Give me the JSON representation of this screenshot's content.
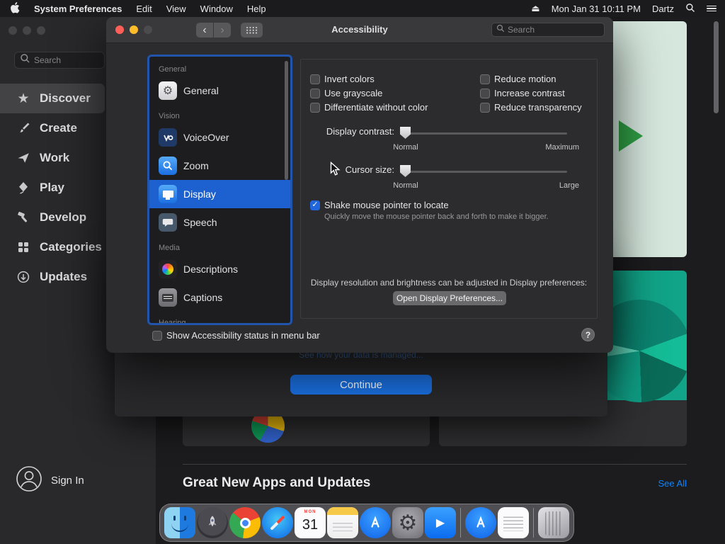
{
  "menubar": {
    "app_name": "System Preferences",
    "menus": [
      "Edit",
      "View",
      "Window",
      "Help"
    ],
    "clock": "Mon Jan 31 10:11 PM",
    "user": "Dartz"
  },
  "icons": {
    "star": "★",
    "eject": "⏏",
    "chevron_left": "‹",
    "chevron_right": "›",
    "gear": "⚙",
    "play": "▶",
    "check": "✓"
  },
  "appstore": {
    "search_placeholder": "Search",
    "nav": [
      {
        "label": "Discover"
      },
      {
        "label": "Create"
      },
      {
        "label": "Work"
      },
      {
        "label": "Play"
      },
      {
        "label": "Develop"
      },
      {
        "label": "Categories"
      },
      {
        "label": "Updates"
      }
    ],
    "sign_in": "Sign In",
    "heading": "Great New Apps and Updates",
    "see_all": "See All"
  },
  "dialog": {
    "data_link": "See how your data is managed...",
    "continue_label": "Continue"
  },
  "prefs": {
    "window_title": "Accessibility",
    "search_placeholder": "Search",
    "sidebar": {
      "header_general": "General",
      "item_general": "General",
      "header_vision": "Vision",
      "item_voiceover": "VoiceOver",
      "item_zoom": "Zoom",
      "item_display": "Display",
      "item_speech": "Speech",
      "header_media": "Media",
      "item_descriptions": "Descriptions",
      "item_captions": "Captions",
      "header_hearing": "Hearing"
    },
    "panel": {
      "cb_invert": "Invert colors",
      "cb_grayscale": "Use grayscale",
      "cb_differentiate": "Differentiate without color",
      "cb_reduce_motion": "Reduce motion",
      "cb_increase_contrast": "Increase contrast",
      "cb_reduce_transparency": "Reduce transparency",
      "contrast_label": "Display contrast:",
      "contrast_min": "Normal",
      "contrast_max": "Maximum",
      "cursor_label": "Cursor size:",
      "cursor_min": "Normal",
      "cursor_max": "Large",
      "shake_label": "Shake mouse pointer to locate",
      "shake_desc": "Quickly move the mouse pointer back and forth to make it bigger.",
      "display_note": "Display resolution and brightness can be adjusted in Display preferences:",
      "open_display_button": "Open Display Preferences...",
      "status_checkbox": "Show Accessibility status in menu bar",
      "help_label": "?"
    }
  },
  "dock": {
    "calendar_day": "31",
    "items": [
      "Finder",
      "Launchpad",
      "Chrome",
      "Safari",
      "Calendar",
      "Notes",
      "App Store",
      "System Preferences",
      "TV",
      "App Store",
      "TextEdit",
      "Trash"
    ]
  },
  "colors": {
    "accent_blue": "#1a6fe0",
    "selection_blue": "#1c61cf",
    "link_blue": "#0a84ff"
  }
}
